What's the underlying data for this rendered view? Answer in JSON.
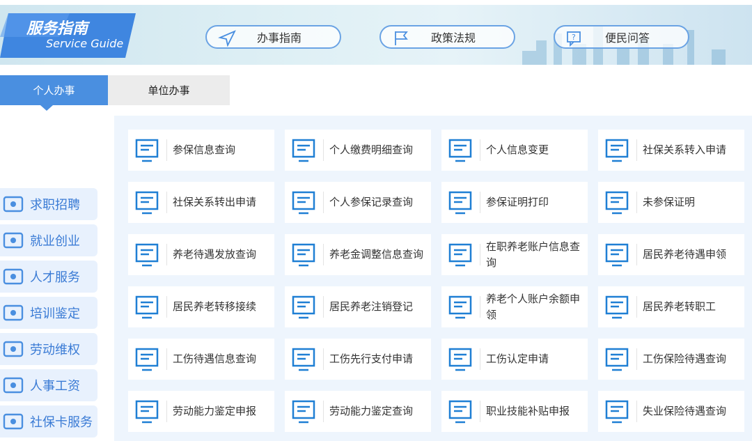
{
  "header": {
    "title": "服务指南",
    "subtitle": "Service Guide",
    "nav": [
      {
        "label": "办事指南",
        "icon": "navigation-arrow-icon"
      },
      {
        "label": "政策法规",
        "icon": "flag-icon"
      },
      {
        "label": "便民问答",
        "icon": "question-chat-icon"
      }
    ]
  },
  "tabs": [
    {
      "label": "个人办事",
      "active": true
    },
    {
      "label": "单位办事",
      "active": false
    }
  ],
  "sidebar": [
    {
      "label": "求职招聘",
      "icon": "speaker-podium-icon"
    },
    {
      "label": "就业创业",
      "icon": "briefcase-icon"
    },
    {
      "label": "人才服务",
      "icon": "graduation-cap-icon"
    },
    {
      "label": "培训鉴定",
      "icon": "book-search-icon"
    },
    {
      "label": "劳动维权",
      "icon": "gavel-icon"
    },
    {
      "label": "人事工资",
      "icon": "card-icon"
    },
    {
      "label": "社保卡服务",
      "icon": "cards-icon"
    }
  ],
  "services": [
    "参保信息查询",
    "个人缴费明细查询",
    "个人信息变更",
    "社保关系转入申请",
    "社保关系转出申请",
    "个人参保记录查询",
    "参保证明打印",
    "未参保证明",
    "养老待遇发放查询",
    "养老金调整信息查询",
    "在职养老账户信息查询",
    "居民养老待遇申领",
    "居民养老转移接续",
    "居民养老注销登记",
    "养老个人账户余额申领",
    "居民养老转职工",
    "工伤待遇信息查询",
    "工伤先行支付申请",
    "工伤认定申请",
    "工伤保险待遇查询",
    "劳动能力鉴定申报",
    "劳动能力鉴定查询",
    "职业技能补贴申报",
    "失业保险待遇查询"
  ],
  "colors": {
    "accent": "#4a8fe0",
    "icon": "#1f7fd4",
    "sidebar_text": "#3a7bd5"
  }
}
